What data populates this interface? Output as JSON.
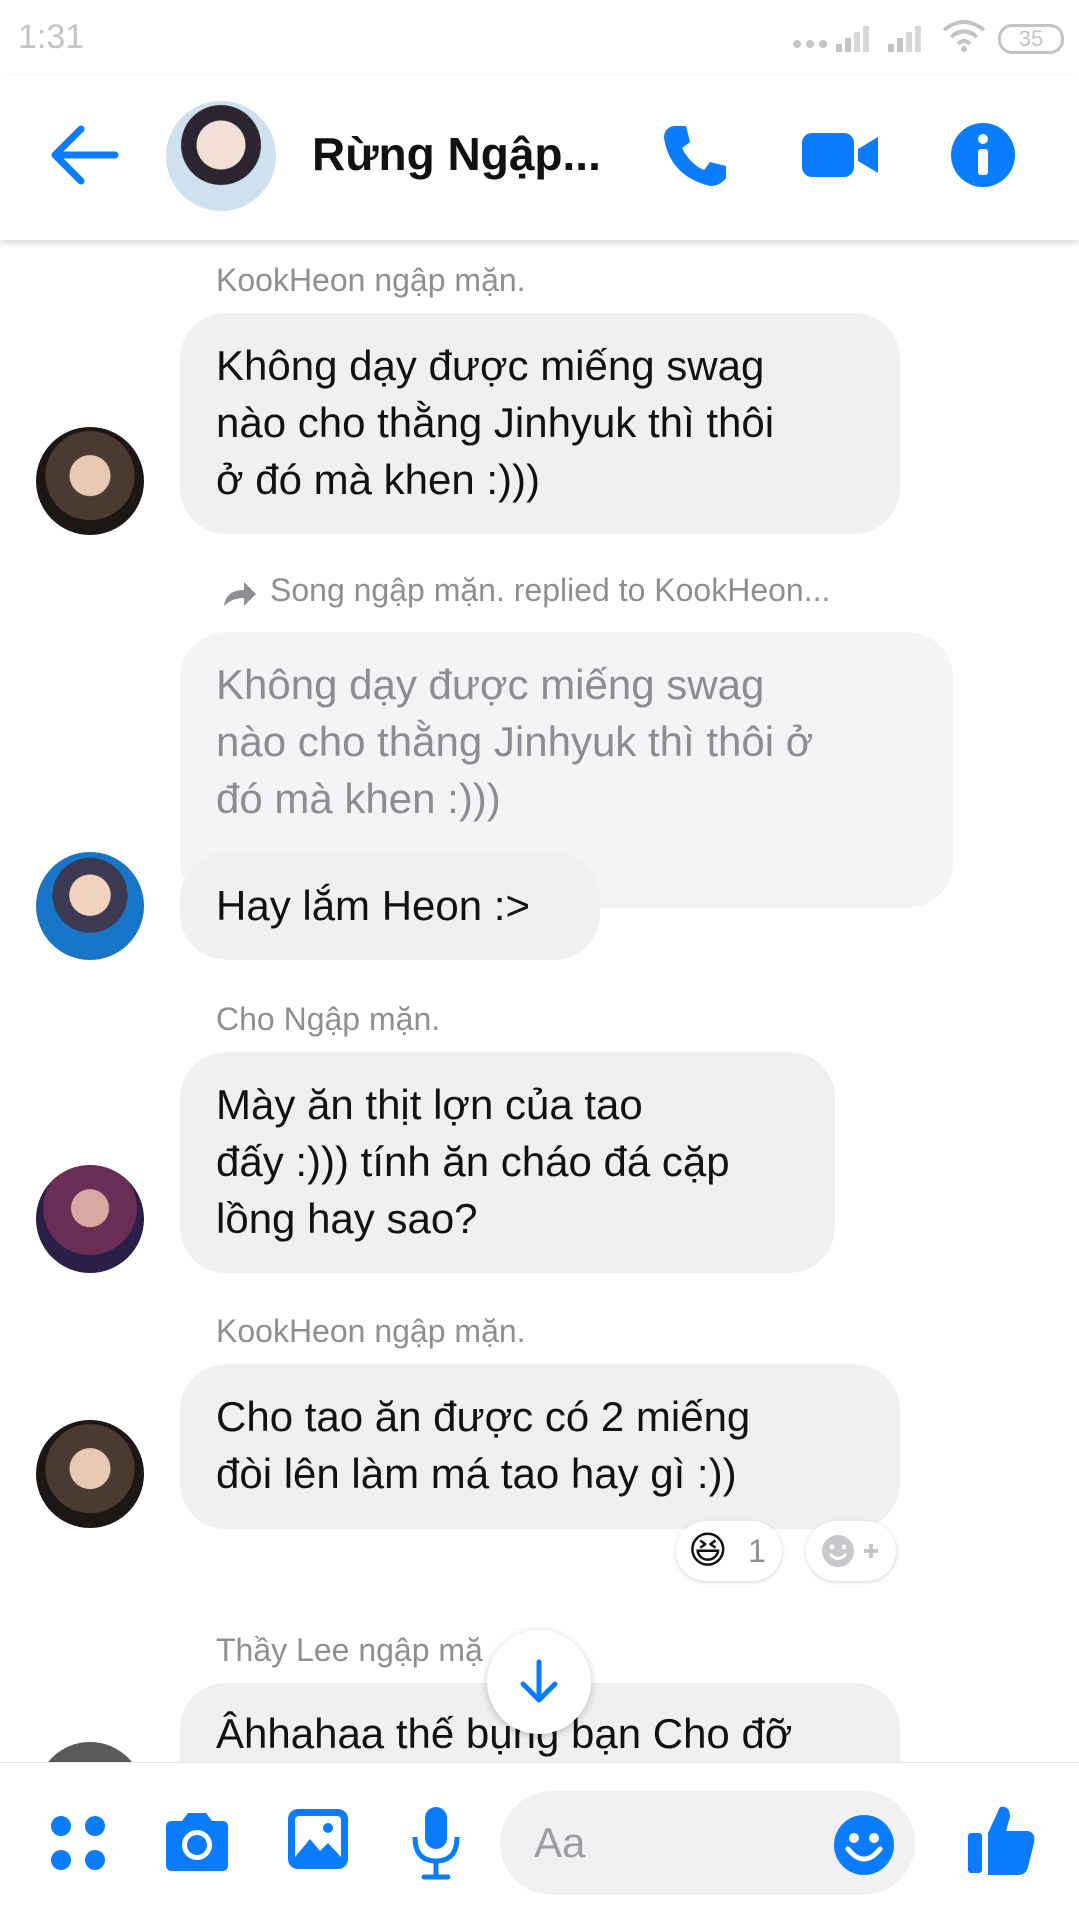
{
  "status_bar": {
    "time": "1:31",
    "battery": "35"
  },
  "header": {
    "title": "Rừng Ngập..."
  },
  "messages": [
    {
      "sender": "KookHeon ngập mặn.",
      "text": [
        "Không dạy được miếng swag",
        "nào cho thằng Jinhyuk thì thôi",
        "ở đó mà khen :)))"
      ]
    },
    {
      "reply_line": "Song ngập mặn. replied to KookHeon...",
      "quoted": [
        "Không dạy được miếng swag",
        "nào cho thằng Jinhyuk thì thôi ở",
        "đó mà khen :)))"
      ],
      "text": "Hay lắm Heon :>"
    },
    {
      "sender": "Cho Ngập mặn.",
      "text": [
        "Mày ăn thịt lợn của tao",
        "đấy :))) tính ăn cháo đá cặp",
        "lồng hay sao?"
      ]
    },
    {
      "sender": "KookHeon ngập mặn.",
      "text": [
        "Cho tao ăn được có 2 miếng",
        "đòi lên làm má tao hay gì :))"
      ],
      "reaction": {
        "emoji": "😆",
        "count": "1"
      }
    },
    {
      "sender": "Thầy Lee ngập mặ",
      "text": "Âhhahaa thế bụng bạn Cho đỡ"
    }
  ],
  "composer": {
    "placeholder": "Aa"
  },
  "colors": {
    "accent": "#0a7cff",
    "bubble": "#f1f0f0",
    "meta": "#8d8f93"
  },
  "icons": [
    "back-arrow-icon",
    "phone-icon",
    "video-camera-icon",
    "info-icon",
    "reply-arrow-icon",
    "scroll-down-arrow-icon",
    "apps-grid-icon",
    "camera-icon",
    "image-icon",
    "microphone-icon",
    "emoji-icon",
    "thumbs-up-icon",
    "add-reaction-icon"
  ]
}
